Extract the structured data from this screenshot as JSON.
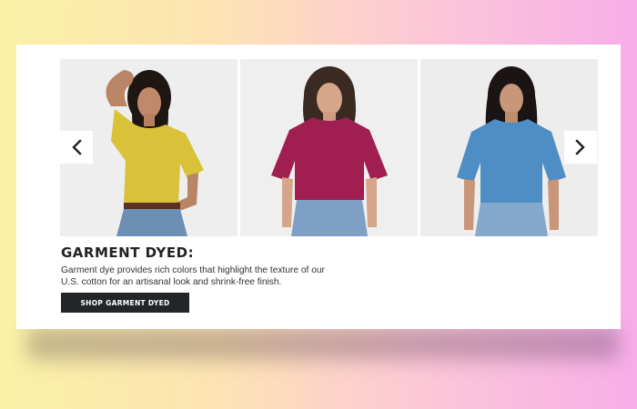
{
  "promo": {
    "heading": "GARMENT DYED:",
    "description": "Garment dye provides rich colors that highlight the texture of our U.S. cotton for an artisanal look and shrink-free finish.",
    "cta_label": "SHOP GARMENT DYED"
  },
  "carousel": {
    "prev_icon": "chevron-left-icon",
    "next_icon": "chevron-right-icon",
    "slides": [
      {
        "shirt_color": "#d9c23a"
      },
      {
        "shirt_color": "#a01f50"
      },
      {
        "shirt_color": "#4f8ec4"
      }
    ]
  },
  "colors": {
    "button_bg": "#222629",
    "heading_text": "#222222"
  }
}
